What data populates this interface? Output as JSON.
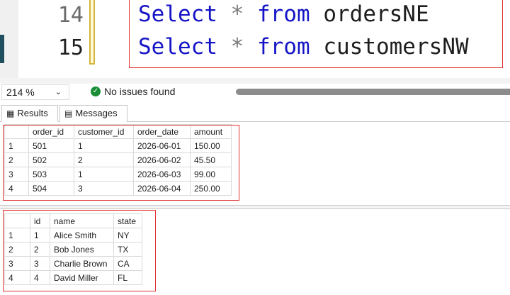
{
  "editor": {
    "line_numbers": [
      "14",
      "15"
    ],
    "lines": [
      {
        "kw1": "Select",
        "op": "*",
        "kw2": "from",
        "ident": "ordersNE"
      },
      {
        "kw1": "Select",
        "op": "*",
        "kw2": "from",
        "ident": "customersNW"
      }
    ]
  },
  "status": {
    "zoom": "214 %",
    "zoom_icon": "chevron-down-icon",
    "issues": "No issues found",
    "issues_icon": "check-circle-icon",
    "issues_color": "#1a8e36"
  },
  "tabs": {
    "results": "Results",
    "results_icon": "grid-icon",
    "messages": "Messages",
    "messages_icon": "messages-icon"
  },
  "grid1": {
    "headers": [
      "",
      "order_id",
      "customer_id",
      "order_date",
      "amount"
    ],
    "rows": [
      [
        "1",
        "501",
        "1",
        "2026-06-01",
        "150.00"
      ],
      [
        "2",
        "502",
        "2",
        "2026-06-02",
        "45.50"
      ],
      [
        "3",
        "503",
        "1",
        "2026-06-03",
        "99.00"
      ],
      [
        "4",
        "504",
        "3",
        "2026-06-04",
        "250.00"
      ]
    ]
  },
  "grid2": {
    "headers": [
      "",
      "id",
      "name",
      "state"
    ],
    "rows": [
      [
        "1",
        "1",
        "Alice Smith",
        "NY"
      ],
      [
        "2",
        "2",
        "Bob Jones",
        "TX"
      ],
      [
        "3",
        "3",
        "Charlie Brown",
        "CA"
      ],
      [
        "4",
        "4",
        "David Miller",
        "FL"
      ]
    ]
  },
  "colors": {
    "keyword": "#1515c6",
    "highlight_box": "#e03131",
    "change_marker": "#d4b53c"
  }
}
